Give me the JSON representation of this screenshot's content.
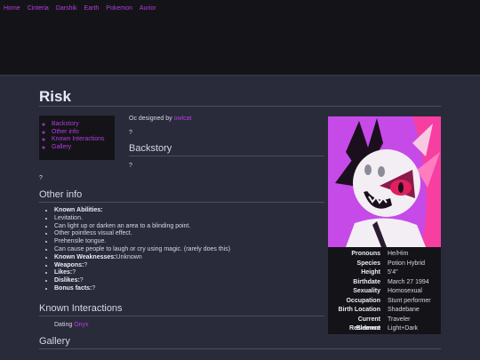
{
  "nav": {
    "items": [
      "Home",
      "Cinteria",
      "Darshik",
      "Earth",
      "Pokemon",
      "Aurior"
    ]
  },
  "page": {
    "title": "Risk",
    "credit_prefix": "Oc designed by",
    "credit_author": "owlcat",
    "placeholder": "?"
  },
  "toc": {
    "items": [
      "Backstory",
      "Other info",
      "Known Interactions",
      "Gallery"
    ]
  },
  "sections": {
    "backstory": "Backstory",
    "other_info": "Other info",
    "known_interactions": "Known Interactions",
    "gallery": "Gallery"
  },
  "other_info": {
    "abilities_label": "Known Abilities:",
    "abilities": [
      "Levitation.",
      "Can light up or darken an area to a blinding point.",
      "Other pointless visual effect.",
      "Prehensile tongue.",
      "Can cause people to laugh or cry using magic. (rarely does this)"
    ],
    "weaknesses_label": "Known Weaknesses:",
    "weaknesses_value": "Unknown",
    "weapons_label": "Weapons:",
    "weapons_value": "?",
    "likes_label": "Likes:",
    "likes_value": "?",
    "dislikes_label": "Dislikes:",
    "dislikes_value": "?",
    "bonus_label": "Bonus facts:",
    "bonus_value": "?"
  },
  "interactions": {
    "dating_label": "Dating",
    "dating_name": "Onyx"
  },
  "infobox": {
    "stats": [
      {
        "label": "Pronouns",
        "value": "He/Him"
      },
      {
        "label": "Species",
        "value": "Potion Hybrid"
      },
      {
        "label": "Height",
        "value": "5'4\""
      },
      {
        "label": "Birthdate",
        "value": "March 27 1994"
      },
      {
        "label": "Sexuality",
        "value": "Homosexual"
      },
      {
        "label": "Occupation",
        "value": "Stunt performer"
      },
      {
        "label": "Birth Location",
        "value": "Shadebane"
      },
      {
        "label": "Current Residence",
        "value": "Traveler"
      },
      {
        "label": "Element",
        "value": "Light+Dark"
      }
    ]
  },
  "colors": {
    "accent": "#b33de0",
    "background": "#2a2b3a",
    "panel": "#141418",
    "portrait_bg": "#c64ae8"
  }
}
